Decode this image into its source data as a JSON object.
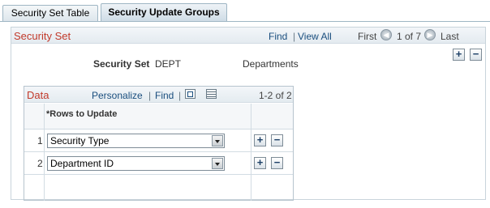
{
  "tabs": [
    {
      "label": "Security Set Table",
      "active": false
    },
    {
      "label": "Security Update Groups",
      "active": true
    }
  ],
  "security_set": {
    "title": "Security Set",
    "nav": {
      "find": "Find",
      "separator": "|",
      "view_all": "View All",
      "first": "First",
      "count": "1 of 7",
      "last": "Last"
    },
    "row_add": "+",
    "row_delete": "−",
    "field_label": "Security Set",
    "field_value": "DEPT",
    "field_description": "Departments"
  },
  "grid": {
    "title": "Data",
    "personalize": "Personalize",
    "separator": "|",
    "find": "Find",
    "count": "1-2 of 2",
    "column_header": "*Rows to Update",
    "rows": [
      {
        "num": "1",
        "value": "Security Type",
        "add": "+",
        "delete": "−"
      },
      {
        "num": "2",
        "value": "Department ID",
        "add": "+",
        "delete": "−"
      }
    ]
  }
}
